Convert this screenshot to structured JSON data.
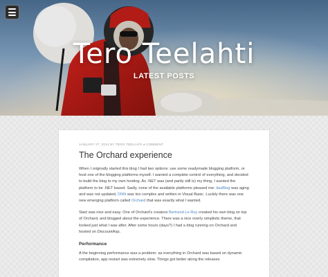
{
  "header": {
    "menu_icon": "hamburger-menu-icon",
    "site_title": "Tero Teelahti",
    "subtitle": "LATEST POSTS"
  },
  "post": {
    "meta": {
      "date": "JANUARY 27, 2014",
      "by": "BY",
      "author": "TERO TEELAHTI",
      "separator": "♦",
      "comment": "COMMENT"
    },
    "title": "The Orchard experience",
    "p1": {
      "a": "When I originally started this blog I had two options: use some readymade blogging platform, or host one of the blogging platforms myself. I wanted a complete control of everything, and decided to build the blog to my own hosting. As .NET was (and partly still is) my thing, I wanted the platform to be .NET based. Sadly, none of the available platforms pleased me: ",
      "link1": "dasBlog",
      "b": " was aging and was not updated, ",
      "link2": "DNN",
      "c": " was too complex and written in Visual Basic. Luckily there was one new emerging platform called ",
      "link3": "Orchard",
      "d": " that was exactly what I wanted."
    },
    "p2": {
      "a": "Start was nice and easy. One of Orchard's creators ",
      "link1": "Bertrand Le Roy",
      "b": " created his own blog on top of Orchard, and blogged about the experience. There was a nice overly simplistic theme, that looked just what I was after. After some hours (days?) I had a blog running on Orchard and hosted on DiscountAsp."
    },
    "heading": "Performance",
    "p3": "A the beginning performance was a problem: as everything in Orchard was based on dynamic compilation, app restart was extremely slow. Things got better along the releases"
  }
}
